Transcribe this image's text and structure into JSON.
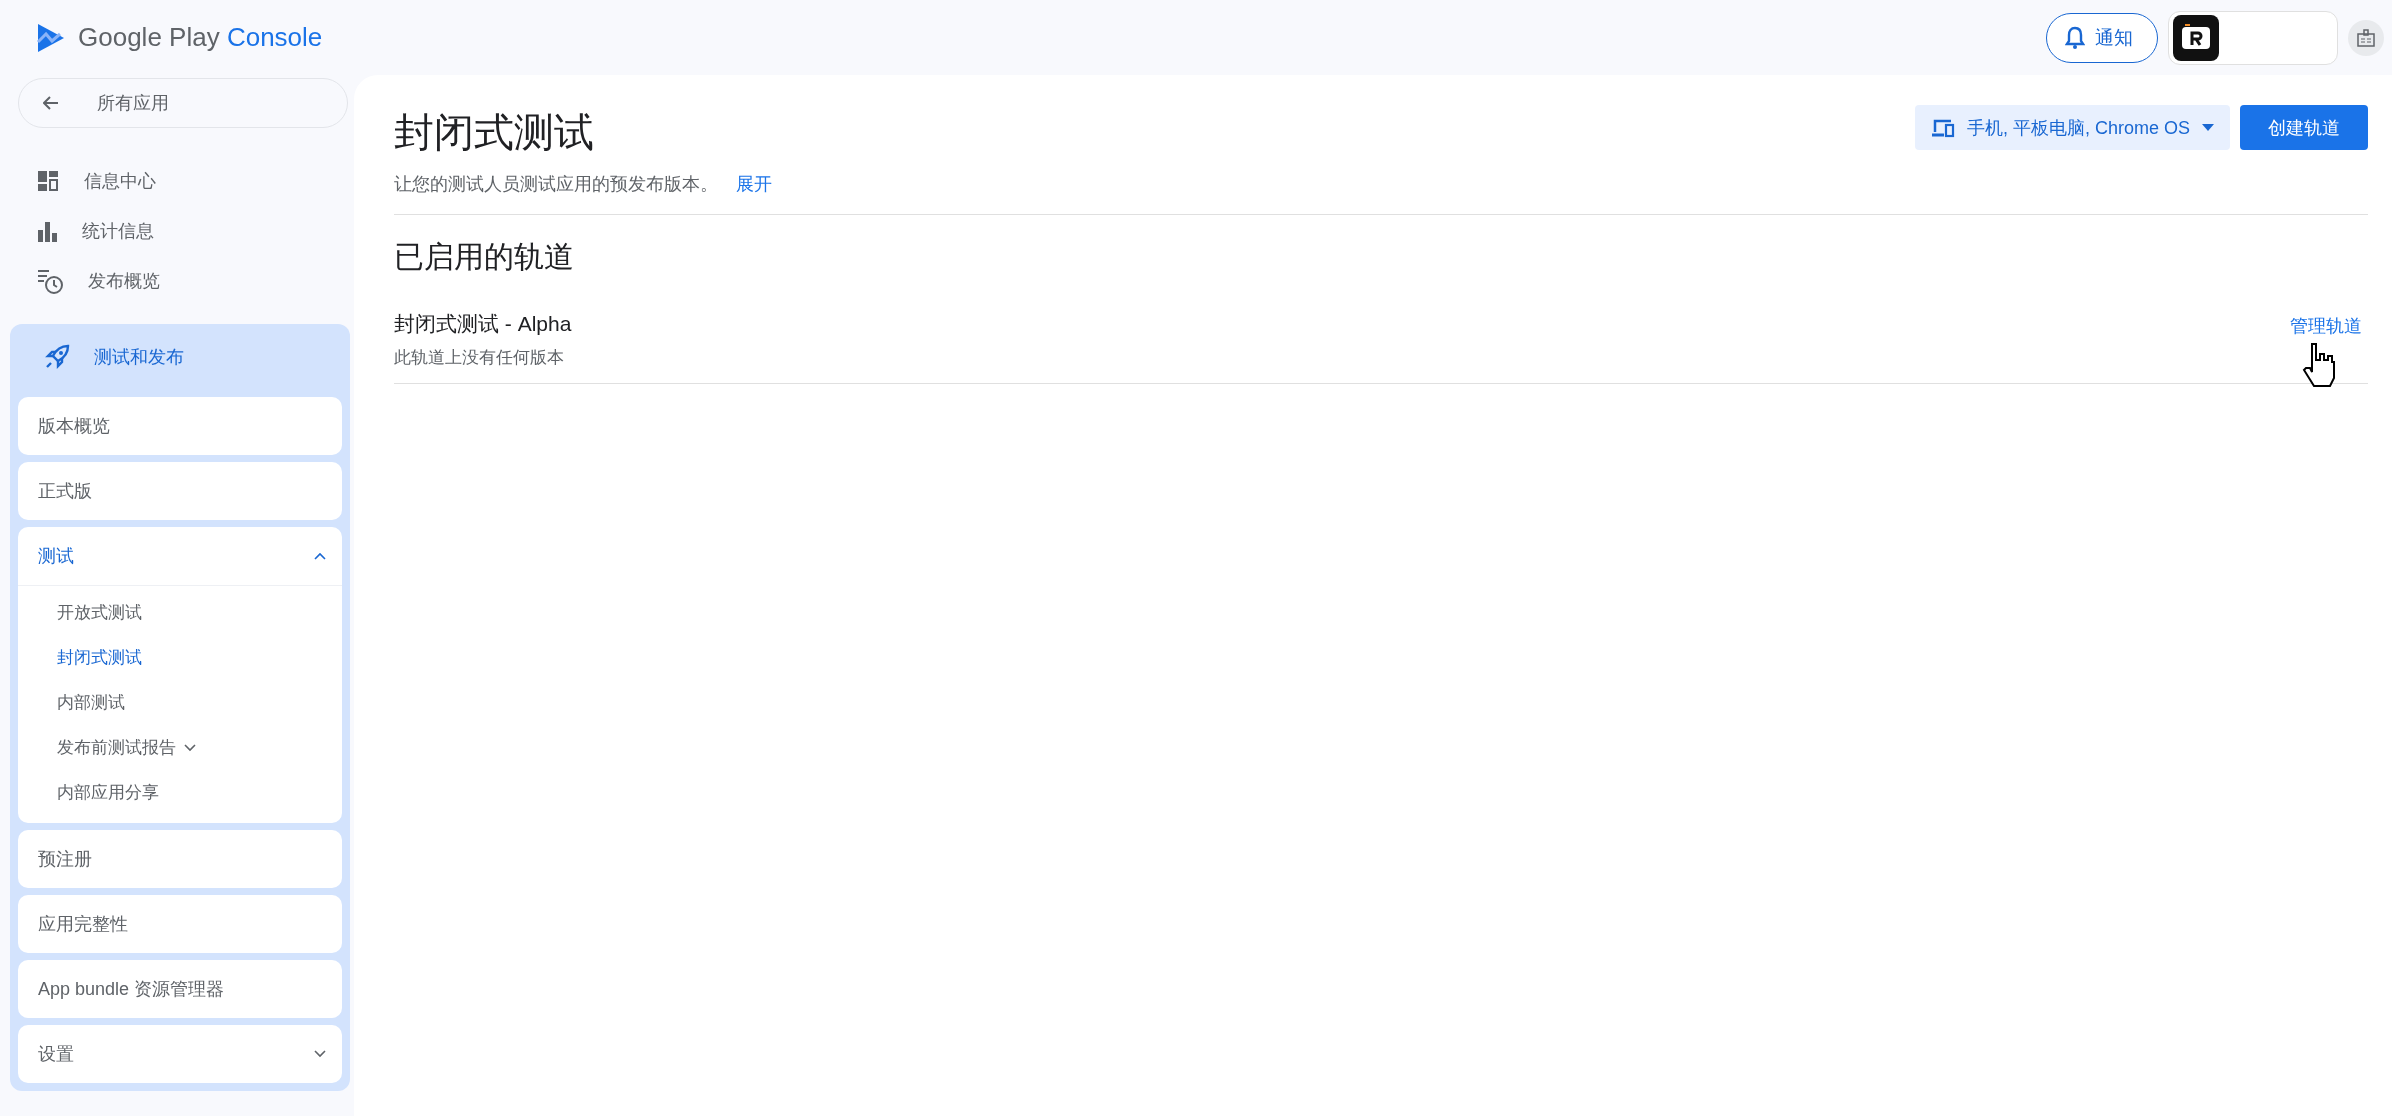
{
  "header": {
    "logo_brand": "Google Play",
    "logo_product": "Console",
    "notifications_label": "通知"
  },
  "sidebar": {
    "back_label": "所有应用",
    "nav": [
      {
        "label": "信息中心",
        "kind": "dashboard"
      },
      {
        "label": "统计信息",
        "kind": "stats"
      },
      {
        "label": "发布概览",
        "kind": "overview"
      }
    ],
    "section": {
      "label": "测试和发布",
      "items": [
        {
          "label": "版本概览",
          "kind": "link",
          "selected": false
        },
        {
          "label": "正式版",
          "kind": "link",
          "selected": false
        },
        {
          "label": "测试",
          "kind": "group",
          "expanded": true,
          "selected": true,
          "children": [
            {
              "label": "开放式测试",
              "kind": "link",
              "selected": false
            },
            {
              "label": "封闭式测试",
              "kind": "link",
              "selected": true
            },
            {
              "label": "内部测试",
              "kind": "link",
              "selected": false
            },
            {
              "label": "发布前测试报告",
              "kind": "group",
              "expanded": false,
              "selected": false
            },
            {
              "label": "内部应用分享",
              "kind": "link",
              "selected": false
            }
          ]
        },
        {
          "label": "预注册",
          "kind": "link",
          "selected": false
        },
        {
          "label": "应用完整性",
          "kind": "link",
          "selected": false
        },
        {
          "label": "App bundle 资源管理器",
          "kind": "link",
          "selected": false
        },
        {
          "label": "设置",
          "kind": "group",
          "expanded": false,
          "selected": false
        }
      ]
    }
  },
  "main": {
    "title": "封闭式测试",
    "subtitle": "让您的测试人员测试应用的预发布版本。",
    "expand_link": "展开",
    "device_filter": "手机, 平板电脑, Chrome OS",
    "create_button": "创建轨道",
    "section_heading": "已启用的轨道",
    "tracks": [
      {
        "name": "封闭式测试 - Alpha",
        "description": "此轨道上没有任何版本",
        "action": "管理轨道"
      }
    ]
  }
}
